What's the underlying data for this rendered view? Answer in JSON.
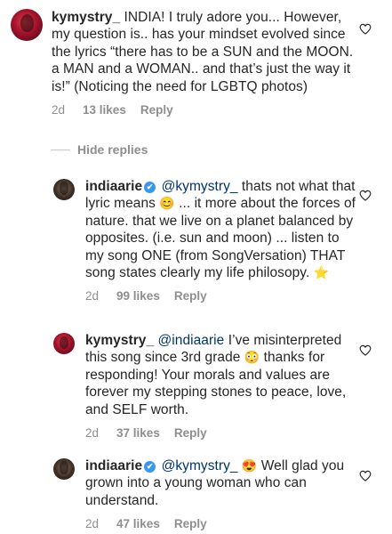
{
  "comments": [
    {
      "username": "kymystry_",
      "text": "INDIA! I truly adore you... However, my question is.. has your mindset evolved since the lyrics “there has to be a SUN and the MOON. a MAN and a WOMAN.. and that’s just the way it is!” (Noticing the need for LGBTQ photos)",
      "time": "2d",
      "likes": "13 likes",
      "reply": "Reply"
    },
    {
      "username": "indiaarie",
      "verified": "✔",
      "mention": "@kymystry_",
      "text_a": " thats not what that lyric means ",
      "emoji_a": "😊",
      "text_b": " ... it more about the forces of nature. that we live on a planet balanced by opposites. (i.e. sun and moon) ... listen to my song ONE (from SongVersation) THAT song states clearly my life philosopy. ",
      "emoji_b": "⭐",
      "time": "2d",
      "likes": "99 likes",
      "reply": "Reply"
    },
    {
      "username": "kymystry_",
      "mention": "@indiaarie",
      "text_a": " I’ve misinterpreted this song since 3rd grade ",
      "emoji_a": "😳",
      "text_b": " thanks for responding! Your morals and values are forever my stepping stones to peace, love, and SELF worth.",
      "time": "2d",
      "likes": "37 likes",
      "reply": "Reply"
    },
    {
      "username": "indiaarie",
      "verified": "✔",
      "mention": "@kymystry_",
      "emoji_a": "😍",
      "text_a": " Well glad you grown into a young woman who can understand.",
      "time": "2d",
      "likes": "47 likes",
      "reply": "Reply"
    }
  ],
  "hide_replies": "Hide replies",
  "icons": {
    "like": "heart-outline-icon",
    "verified": "verified-badge-icon"
  },
  "colors": {
    "text": "#262626",
    "muted": "#8e8e8e",
    "mention": "#003569",
    "verified": "#3897f0"
  }
}
